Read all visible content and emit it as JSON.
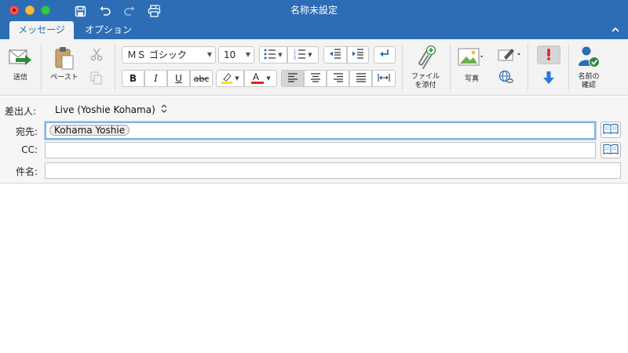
{
  "window": {
    "title": "名称未設定"
  },
  "titlebar": {
    "buttons": [
      "close",
      "minimize",
      "zoom"
    ],
    "quick_access": [
      "save-icon",
      "undo-icon",
      "redo-icon",
      "print-icon"
    ]
  },
  "tabs": [
    {
      "label": "メッセージ",
      "active": true
    },
    {
      "label": "オプション",
      "active": false
    }
  ],
  "ribbon": {
    "send": {
      "label": "送信",
      "icon": "send-icon"
    },
    "paste": {
      "label": "ペースト",
      "icon": "paste-icon"
    },
    "font": {
      "name": "ＭＳ ゴシック",
      "size": "10"
    },
    "format_buttons": [
      {
        "label": "B",
        "icon": "bold-icon"
      },
      {
        "label": "I",
        "icon": "italic-icon"
      },
      {
        "label": "U",
        "icon": "underline-icon"
      },
      {
        "label": "abc",
        "icon": "strikethrough-icon"
      }
    ],
    "attach": {
      "label_line1": "ファイル",
      "label_line2": "を添付",
      "icon": "paperclip-icon"
    },
    "photo": {
      "label": "写真",
      "icon": "picture-icon"
    },
    "check_names": {
      "label_line1": "名前の",
      "label_line2": "確認",
      "icon": "check-names-icon"
    },
    "colors": {
      "accent": "#2c6db6",
      "highlight": "#f7e31b",
      "font_color": "#e02020",
      "importance_high": "#e0262a",
      "importance_low": "#2b79d8"
    }
  },
  "fields": {
    "from_label": "差出人:",
    "from_value": "Live (Yoshie Kohama)",
    "to_label": "宛先:",
    "to_recipient": "Kohama Yoshie",
    "cc_label": "CC:",
    "cc_value": "",
    "subject_label": "件名:",
    "subject_value": ""
  },
  "body": {
    "text": ""
  }
}
